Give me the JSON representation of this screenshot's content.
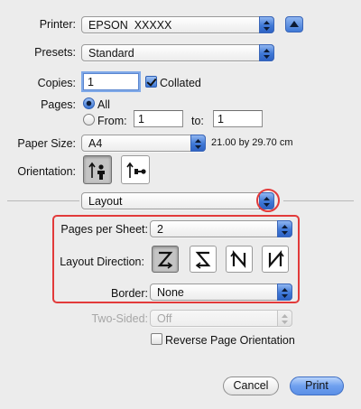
{
  "printer": {
    "label": "Printer:",
    "value": "EPSON  XXXXX"
  },
  "presets": {
    "label": "Presets:",
    "value": "Standard"
  },
  "copies": {
    "label": "Copies:",
    "value": "1",
    "collated_label": "Collated"
  },
  "pages": {
    "label": "Pages:",
    "all_label": "All",
    "from_label": "From:",
    "from_value": "1",
    "to_label": "to:",
    "to_value": "1"
  },
  "paper_size": {
    "label": "Paper Size:",
    "value": "A4",
    "dimensions": "21.00 by 29.70 cm"
  },
  "orientation": {
    "label": "Orientation:"
  },
  "panel_select": {
    "value": "Layout"
  },
  "layout": {
    "pages_per_sheet_label": "Pages per Sheet:",
    "pages_per_sheet_value": "2",
    "direction_label": "Layout Direction:",
    "border_label": "Border:",
    "border_value": "None",
    "two_sided_label": "Two-Sided:",
    "two_sided_value": "Off",
    "reverse_label": "Reverse Page Orientation"
  },
  "buttons": {
    "cancel": "Cancel",
    "print": "Print"
  },
  "colors": {
    "highlight": "#e23a3a",
    "accent": "#3f78d6"
  }
}
